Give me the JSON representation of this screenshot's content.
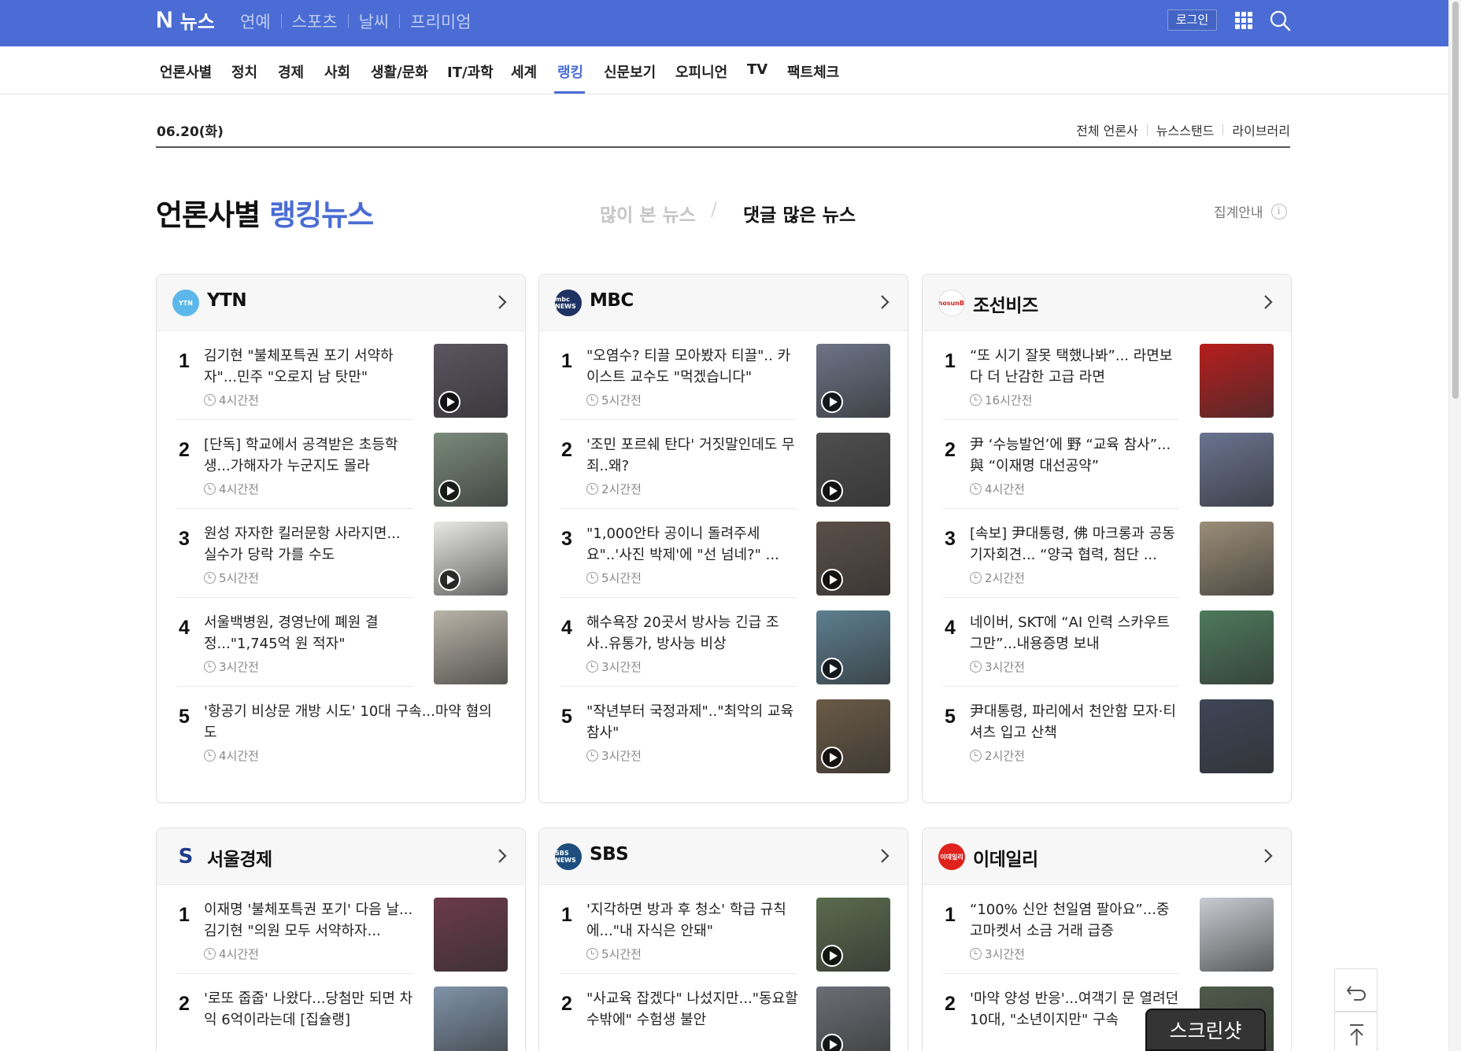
{
  "header": {
    "logo_n": "N",
    "logo_news": "뉴스",
    "services": [
      "연예",
      "스포츠",
      "날씨",
      "프리미엄"
    ],
    "login_label": "로그인"
  },
  "nav": {
    "items": [
      "언론사별",
      "정치",
      "경제",
      "사회",
      "생활/문화",
      "IT/과학",
      "세계",
      "랭킹",
      "신문보기",
      "오피니언",
      "TV",
      "팩트체크"
    ],
    "active": "랭킹"
  },
  "dateline": {
    "date": "06.20(화)",
    "links": [
      "전체 언론사",
      "뉴스스탠드",
      "라이브러리"
    ]
  },
  "ranking": {
    "title_plain": "언론사별 ",
    "title_accent": "랭킹뉴스",
    "tab_viewed": "많이 본 뉴스",
    "tab_slash": "/",
    "tab_comments": "댓글 많은 뉴스",
    "info_label": "집계안내",
    "info_icon": "i"
  },
  "press_cards": [
    {
      "name": "YTN",
      "logo_text": "YTN",
      "logo_color": "#5cb8ea",
      "items": [
        {
          "rank": "1",
          "title": "김기현 \"불체포특권 포기 서약하자\"...민주 \"오로지 남 탓만\"",
          "time": "4시간전",
          "video": true,
          "thumb": "#5a5560"
        },
        {
          "rank": "2",
          "title": "[단독] 학교에서 공격받은 초등학생...가해자가 누군지도 몰라",
          "time": "4시간전",
          "video": true,
          "thumb": "#7a8a7c"
        },
        {
          "rank": "3",
          "title": "원성 자자한 킬러문항 사라지면... 실수가 당락 가를 수도",
          "time": "5시간전",
          "video": true,
          "thumb": "#e8e8e6"
        },
        {
          "rank": "4",
          "title": "서울백병원, 경영난에 폐원 결정...\"1,745억 원 적자\"",
          "time": "3시간전",
          "video": false,
          "thumb": "#b9b4a8"
        },
        {
          "rank": "5",
          "title": "'항공기 비상문 개방 시도' 10대 구속...마약 혐의도",
          "time": "4시간전",
          "video": false,
          "thumb": ""
        }
      ]
    },
    {
      "name": "MBC",
      "logo_text": "mbc NEWS",
      "logo_color": "#1e3263",
      "items": [
        {
          "rank": "1",
          "title": "\"오염수? 티끌 모아봤자 티끌\".. 카이스트 교수도 \"먹겠습니다\"",
          "time": "5시간전",
          "video": true,
          "thumb": "#6c7486"
        },
        {
          "rank": "2",
          "title": "'조민 포르쉐 탄다' 거짓말인데도 무죄..왜?",
          "time": "2시간전",
          "video": true,
          "thumb": "#4e4e4e"
        },
        {
          "rank": "3",
          "title": "\"1,000안타 공이니 돌려주세요\"..'사진 박제'에 \"선 넘네?\" ...",
          "time": "5시간전",
          "video": true,
          "thumb": "#5b4f48"
        },
        {
          "rank": "4",
          "title": "해수욕장 20곳서 방사능 긴급 조사..유통가, 방사능 비상",
          "time": "3시간전",
          "video": true,
          "thumb": "#5d7f90"
        },
        {
          "rank": "5",
          "title": "\"작년부터 국정과제\"..\"최악의 교육참사\"",
          "time": "3시간전",
          "video": true,
          "thumb": "#6a5a46"
        }
      ]
    },
    {
      "name": "조선비즈",
      "logo_text": "ChosunBiz",
      "logo_color": "#ffffff",
      "items": [
        {
          "rank": "1",
          "title": "“또 시기 잘못 택했나봐”... 라면보다 더 난감한 고급 라면",
          "time": "16시간전",
          "video": false,
          "thumb": "#b81d1d"
        },
        {
          "rank": "2",
          "title": "尹 ‘수능발언’에 野 “교육 참사”... 與 “이재명 대선공약”",
          "time": "4시간전",
          "video": false,
          "thumb": "#6a7390"
        },
        {
          "rank": "3",
          "title": "[속보] 尹대통령, 佛 마크롱과 공동기자회견... “양국 협력, 첨단 ...",
          "time": "2시간전",
          "video": false,
          "thumb": "#9b8e78"
        },
        {
          "rank": "4",
          "title": "네이버, SKT에 “AI 인력 스카우트 그만”...내용증명 보내",
          "time": "3시간전",
          "video": false,
          "thumb": "#4d7a5c"
        },
        {
          "rank": "5",
          "title": "尹대통령, 파리에서 천안함 모자·티셔츠 입고 산책",
          "time": "2시간전",
          "video": false,
          "thumb": "#3e4556"
        }
      ]
    },
    {
      "name": "서울경제",
      "logo_text": "S",
      "logo_color": "#ffffff",
      "items": [
        {
          "rank": "1",
          "title": "이재명 '불체포특권 포기' 다음 날...김기현 \"의원 모두 서약하자...",
          "time": "4시간전",
          "video": false,
          "thumb": "#6b3a4a"
        },
        {
          "rank": "2",
          "title": "'로또 줍줍' 나왔다...당첨만 되면 차익 6억이라는데 [집슐랭]",
          "time": "",
          "video": false,
          "thumb": "#7f93a8"
        }
      ]
    },
    {
      "name": "SBS",
      "logo_text": "SBS NEWS",
      "logo_color": "#1d4e7e",
      "items": [
        {
          "rank": "1",
          "title": "'지각하면 방과 후 청소' 학급 규칙에...\"내 자식은 안돼\"",
          "time": "5시간전",
          "video": true,
          "thumb": "#5b6b4e"
        },
        {
          "rank": "2",
          "title": "\"사교육 잡겠다\" 나섰지만...\"동요할 수밖에\" 수험생 불안",
          "time": "",
          "video": true,
          "thumb": "#6a6e74"
        }
      ]
    },
    {
      "name": "이데일리",
      "logo_text": "이데일리",
      "logo_color": "#e0221c",
      "items": [
        {
          "rank": "1",
          "title": "“100% 신안 천일염 팔아요”...중고마켓서 소금 거래 급증",
          "time": "3시간전",
          "video": false,
          "thumb": "#c9ccd2"
        },
        {
          "rank": "2",
          "title": "'마약 양성 반응'...여객기 문 열려던 10대, \"소년이지만\" 구속",
          "time": "",
          "video": false,
          "thumb": "#4f5a4a"
        }
      ]
    }
  ],
  "floating": {
    "screenshot_label": "스크린샷"
  }
}
